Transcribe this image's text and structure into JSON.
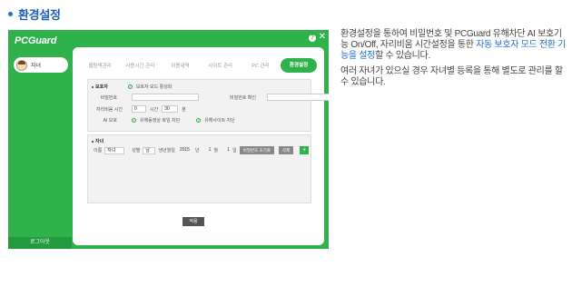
{
  "section": {
    "title": "환경설정"
  },
  "app": {
    "logo": "PCGuard",
    "help_label": "?",
    "close_label": "✕",
    "child_name": "자녀",
    "logout_label": "로그아웃",
    "tabs": [
      {
        "label": "웹탐색관리"
      },
      {
        "label": "사용시간 관리"
      },
      {
        "label": "이용내역"
      },
      {
        "label": "사이트 관리"
      },
      {
        "label": "PC 관리"
      },
      {
        "label": "환경설정",
        "active": true
      }
    ],
    "protect": {
      "heading": "보호자",
      "mode_label": "보호자 모드 활성화",
      "password_label": "비밀번호",
      "password_confirm_label": "비밀번호 확인",
      "unused_time_label": "자리비움 시간",
      "hour_value": "0",
      "hour_unit": "시간",
      "minute_value": "30",
      "minute_unit": "분",
      "ai_label": "AI 보호",
      "ai_option1": "유해동영상 화일 차단",
      "ai_option2": "유해사이트 차단"
    },
    "child": {
      "heading": "자녀",
      "name_label": "이름",
      "name_value": "자녀",
      "gender_label": "성별",
      "gender_value": "남",
      "birth_label": "생년월일",
      "year_value": "2015",
      "year_unit": "년",
      "month_value": "1",
      "month_unit": "월",
      "day_value": "1",
      "day_unit": "일",
      "reset_pw_label": "비밀번호 초기화",
      "delete_label": "삭제",
      "add_label": "+"
    },
    "apply_label": "적용"
  },
  "description": {
    "p1_before": "환경설정을 통하여 비밀번호 및 PCGuard 유해차단 AI 보호기능 On/Off, 자리비움 시간설정을 통한 ",
    "p1_highlight": "자동 보호자 모드 전환 기능을 설정",
    "p1_after": "할 수 있습니다.",
    "p2": "여러 자녀가 있으실 경우 자녀별 등록을 통해 별도로 관리를 할 수 있습니다."
  },
  "colors": {
    "brand_green": "#2fb24c",
    "heading_blue": "#1a5fb4",
    "highlight_blue": "#1f6fd1"
  }
}
